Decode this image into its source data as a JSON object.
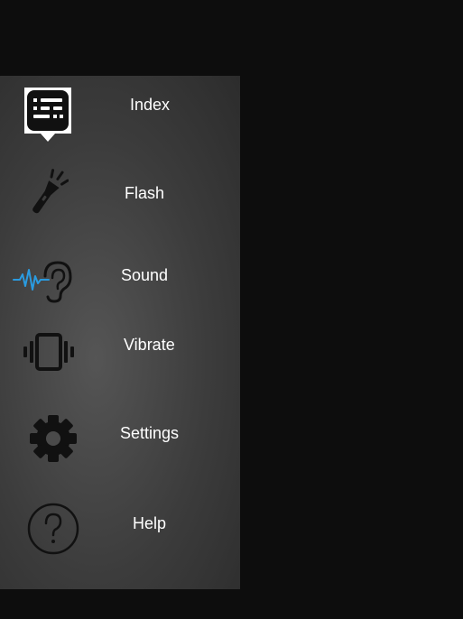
{
  "menu": {
    "items": [
      {
        "id": "index",
        "label": "Index",
        "icon": "index-chat-icon"
      },
      {
        "id": "flash",
        "label": "Flash",
        "icon": "flashlight-icon"
      },
      {
        "id": "sound",
        "label": "Sound",
        "icon": "ear-soundwave-icon"
      },
      {
        "id": "vibrate",
        "label": "Vibrate",
        "icon": "phone-vibrate-icon"
      },
      {
        "id": "settings",
        "label": "Settings",
        "icon": "gear-icon"
      },
      {
        "id": "help",
        "label": "Help",
        "icon": "help-question-icon"
      }
    ]
  },
  "colors": {
    "background": "#0d0d0d",
    "panel": "#3c3c3c",
    "label_text": "#ffffff",
    "icon_dark": "#111111",
    "sound_wave_accent": "#2a9be0"
  }
}
